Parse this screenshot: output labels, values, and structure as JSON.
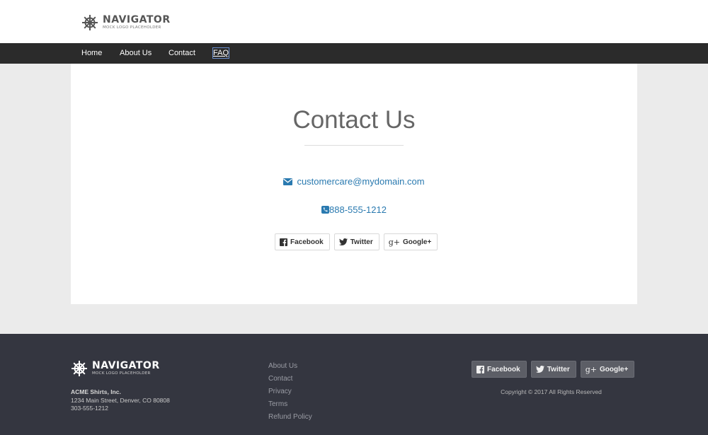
{
  "logo": {
    "title": "NAVIGATOR",
    "subtitle": "MOCK LOGO PLACEHOLDER"
  },
  "nav": {
    "items": [
      {
        "label": "Home"
      },
      {
        "label": "About Us"
      },
      {
        "label": "Contact"
      },
      {
        "label": "FAQ"
      }
    ]
  },
  "main": {
    "title": "Contact Us",
    "email": "customercare@mydomain.com",
    "phone": "888-555-1212"
  },
  "social": {
    "facebook": "Facebook",
    "twitter": "Twitter",
    "googleplus": "Google+",
    "googleplus_glyph": "g+"
  },
  "footer": {
    "company": "ACME Shirts, Inc.",
    "address": "1234 Main Street, Denver, CO 80808",
    "phone": "303-555-1212",
    "links": [
      {
        "label": "About Us"
      },
      {
        "label": "Contact"
      },
      {
        "label": "Privacy"
      },
      {
        "label": "Terms"
      },
      {
        "label": "Refund Policy"
      }
    ],
    "copyright": "Copyright © 2017 All Rights Reserved"
  },
  "colors": {
    "accent": "#2a7ab0",
    "nav_bg": "#2b2b2b",
    "footer_bg": "#343640",
    "page_bg": "#ebebeb"
  },
  "icons": [
    "ship-wheel-icon",
    "envelope-icon",
    "phone-icon",
    "facebook-icon",
    "twitter-icon",
    "google-plus-icon"
  ]
}
